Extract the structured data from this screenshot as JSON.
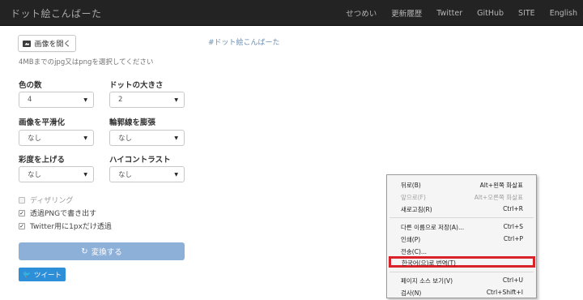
{
  "navbar": {
    "brand": "ドット絵こんばーた",
    "links": [
      "せつめい",
      "更新履歴",
      "Twitter",
      "GitHub",
      "SITE",
      "English"
    ]
  },
  "open_button": {
    "label": "画像を開く",
    "icon": "image-icon"
  },
  "help_text": "4MBまでのjpg又はpngを選択してください",
  "hashtag": "#ドット絵こんばーた",
  "fields": {
    "colors": {
      "label": "色の数",
      "value": "4"
    },
    "dot_size": {
      "label": "ドットの大きさ",
      "value": "2"
    },
    "smoothing": {
      "label": "画像を平滑化",
      "value": "なし"
    },
    "outline": {
      "label": "輪郭線を膨張",
      "value": "なし"
    },
    "saturation": {
      "label": "彩度を上げる",
      "value": "なし"
    },
    "contrast": {
      "label": "ハイコントラスト",
      "value": "なし"
    }
  },
  "checks": {
    "dithering": {
      "label": "ディザリング",
      "checked": false
    },
    "png": {
      "label": "透過PNGで書き出す",
      "checked": true
    },
    "twitter": {
      "label": "Twitter用に1pxだけ透過",
      "checked": true
    }
  },
  "convert_button": {
    "label": "変換する"
  },
  "tweet_button": {
    "label": "ツイート"
  },
  "context_menu": {
    "items": [
      {
        "label": "뒤로(B)",
        "shortcut": "Alt+왼쪽 화살표",
        "disabled": false
      },
      {
        "label": "앞으로(F)",
        "shortcut": "Alt+오른쪽 화살표",
        "disabled": true
      },
      {
        "label": "새로고침(R)",
        "shortcut": "Ctrl+R",
        "disabled": false
      },
      {
        "label": "다른 이름으로 저장(A)...",
        "shortcut": "Ctrl+S",
        "disabled": false
      },
      {
        "label": "인쇄(P)",
        "shortcut": "Ctrl+P",
        "disabled": false
      },
      {
        "label": "전송(C)...",
        "shortcut": "",
        "disabled": false
      },
      {
        "label": "한국어(으)로 번역(T)",
        "shortcut": "",
        "disabled": false,
        "highlighted": true
      },
      {
        "label": "페이지 소스 보기(V)",
        "shortcut": "Ctrl+U",
        "disabled": false
      },
      {
        "label": "검사(N)",
        "shortcut": "Ctrl+Shift+I",
        "disabled": false
      }
    ]
  },
  "colors": {
    "navbar_bg": "#232323",
    "convert_bg": "#8db0d9",
    "tweet_bg": "#2e8fd9",
    "highlight_border": "#d8232a"
  }
}
